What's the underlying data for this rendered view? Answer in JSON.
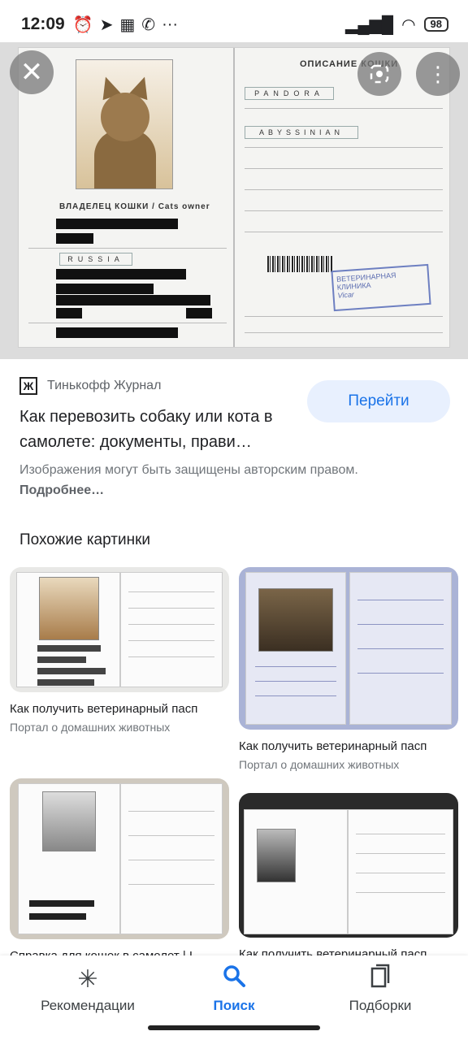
{
  "status_bar": {
    "time": "12:09",
    "icons_left": [
      "alarm-icon",
      "telegram-icon",
      "news-icon",
      "viber-icon"
    ],
    "more": "···",
    "battery": "98"
  },
  "hero": {
    "left_page": {
      "caption": "ВЛАДЕЛЕЦ КОШКИ / Cats owner",
      "country_value": "RUSSIA"
    },
    "right_page": {
      "title": "ОПИСАНИЕ КОШКИ",
      "name_value": "PANDORA",
      "breed_value": "ABYSSINIAN",
      "stamp_text": "ВЕТЕРИНАРНАЯ КЛИНИКА",
      "sign_text": "Vicar"
    }
  },
  "source": {
    "logo_letters": "Ж",
    "name": "Тинькофф Журнал"
  },
  "article": {
    "title": "Как перевозить собаку или кота в самолете: документы, прави…",
    "go_button": "Перейти"
  },
  "copyright": {
    "text": "Изображения могут быть защищены авторским правом. ",
    "more": "Подробнее…"
  },
  "similar": {
    "section_title": "Похожие картинки",
    "items": [
      {
        "title": "Как получить ветеринарный пасп",
        "source": "Портал о домашних животных"
      },
      {
        "title": "Как получить ветеринарный пасп",
        "source": "Портал о домашних животных"
      },
      {
        "title": "Справка для кошек в самолет | L",
        "source": ""
      },
      {
        "title": "Как получить ветеринарный пасп",
        "source": ""
      }
    ]
  },
  "bottom_nav": {
    "items": [
      {
        "label": "Рекомендации",
        "icon": "asterisk-icon"
      },
      {
        "label": "Поиск",
        "icon": "search-icon"
      },
      {
        "label": "Подборки",
        "icon": "bookmark-icon"
      }
    ],
    "active": "Поиск"
  },
  "colors": {
    "accent": "#1a73e8",
    "button_bg": "#e8f0fe"
  }
}
